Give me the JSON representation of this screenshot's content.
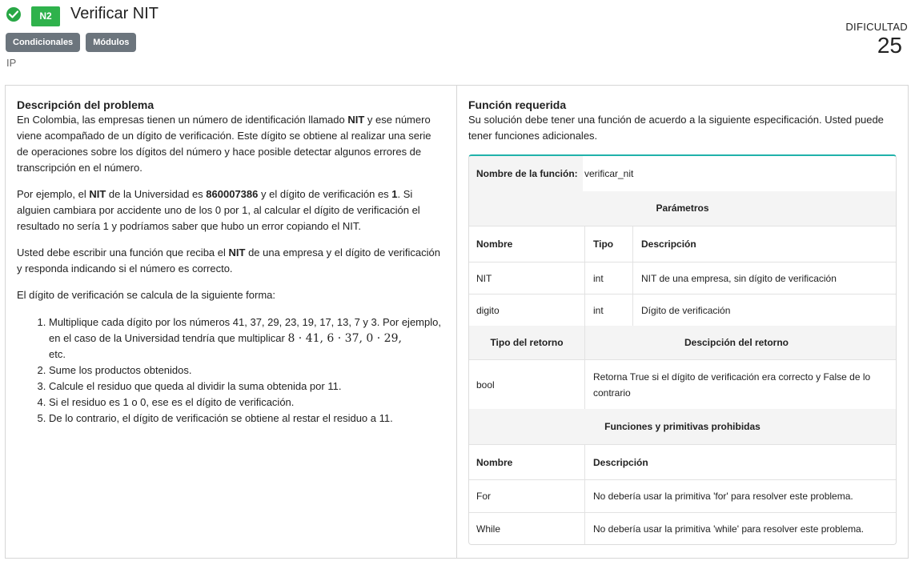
{
  "header": {
    "level": "N2",
    "title": "Verificar NIT",
    "tags": [
      "Condicionales",
      "Módulos"
    ],
    "category": "IP",
    "difficulty_label": "DIFICULTAD",
    "difficulty_value": "25"
  },
  "description": {
    "heading": "Descripción del problema",
    "p1_a": "En Colombia, las empresas tienen un número de identificación llamado ",
    "p1_b": "NIT",
    "p1_c": " y ese número viene acompañado de un dígito de verificación. Este dígito se obtiene al realizar una serie de operaciones sobre los dígitos del número y hace posible detectar algunos errores de transcripción en el número.",
    "p2_a": "Por ejemplo, el ",
    "p2_b": "NIT",
    "p2_c": " de la Universidad es ",
    "p2_d": "860007386",
    "p2_e": " y el dígito de verificación es ",
    "p2_f": "1",
    "p2_g": ". Si alguien cambiara por accidente uno de los 0 por 1, al calcular el dígito de verificación el resultado no sería 1 y podríamos saber que hubo un error copiando el NIT.",
    "p3_a": "Usted debe escribir una función que reciba el ",
    "p3_b": "NIT",
    "p3_c": " de una empresa y el dígito de verificación y responda indicando si el número es correcto.",
    "p4": "El dígito de verificación se calcula de la siguiente forma:",
    "step1_a": "Multiplique cada dígito por los números 41, 37, 29, 23, 19, 17, 13, 7 y 3. Por ejemplo, en el caso de la Universidad tendría que multiplicar ",
    "step1_math": "8 · 41, 6 · 37, 0 · 29,",
    "step1_b": " etc.",
    "step2": "Sume los productos obtenidos.",
    "step3": "Calcule el residuo que queda al dividir la suma obtenida por 11.",
    "step4": "Si el residuo es 1 o 0, ese es el dígito de verificación.",
    "step5": "De lo contrario, el dígito de verificación se obtiene al restar el residuo a 11."
  },
  "function_spec": {
    "heading": "Función requerida",
    "intro": "Su solución debe tener una función de acuerdo a la siguiente especificación. Usted puede tener funciones adicionales.",
    "name_label": "Nombre de la función:",
    "name_value": "verificar_nit",
    "params_title": "Parámetros",
    "params_headers": [
      "Nombre",
      "Tipo",
      "Descripción"
    ],
    "params": [
      {
        "name": "NIT",
        "type": "int",
        "desc": "NIT de una empresa, sin dígito de verificación"
      },
      {
        "name": "digito",
        "type": "int",
        "desc": "Dígito de verificación"
      }
    ],
    "return_type_header": "Tipo del retorno",
    "return_desc_header": "Descipción del retorno",
    "return_type": "bool",
    "return_desc": "Retorna True si el dígito de verificación era correcto y False de lo contrario",
    "prohibited_title": "Funciones y primitivas prohibidas",
    "prohibited_headers": [
      "Nombre",
      "Descripción"
    ],
    "prohibited": [
      {
        "name": "For",
        "desc": "No debería usar la primitiva 'for' para resolver este problema."
      },
      {
        "name": "While",
        "desc": "No debería usar la primitiva 'while' para resolver este problema."
      }
    ]
  },
  "colors": {
    "success": "#28a745",
    "level_badge": "#2fb24c",
    "tag": "#6c757d",
    "accent_border": "#20b2aa"
  }
}
